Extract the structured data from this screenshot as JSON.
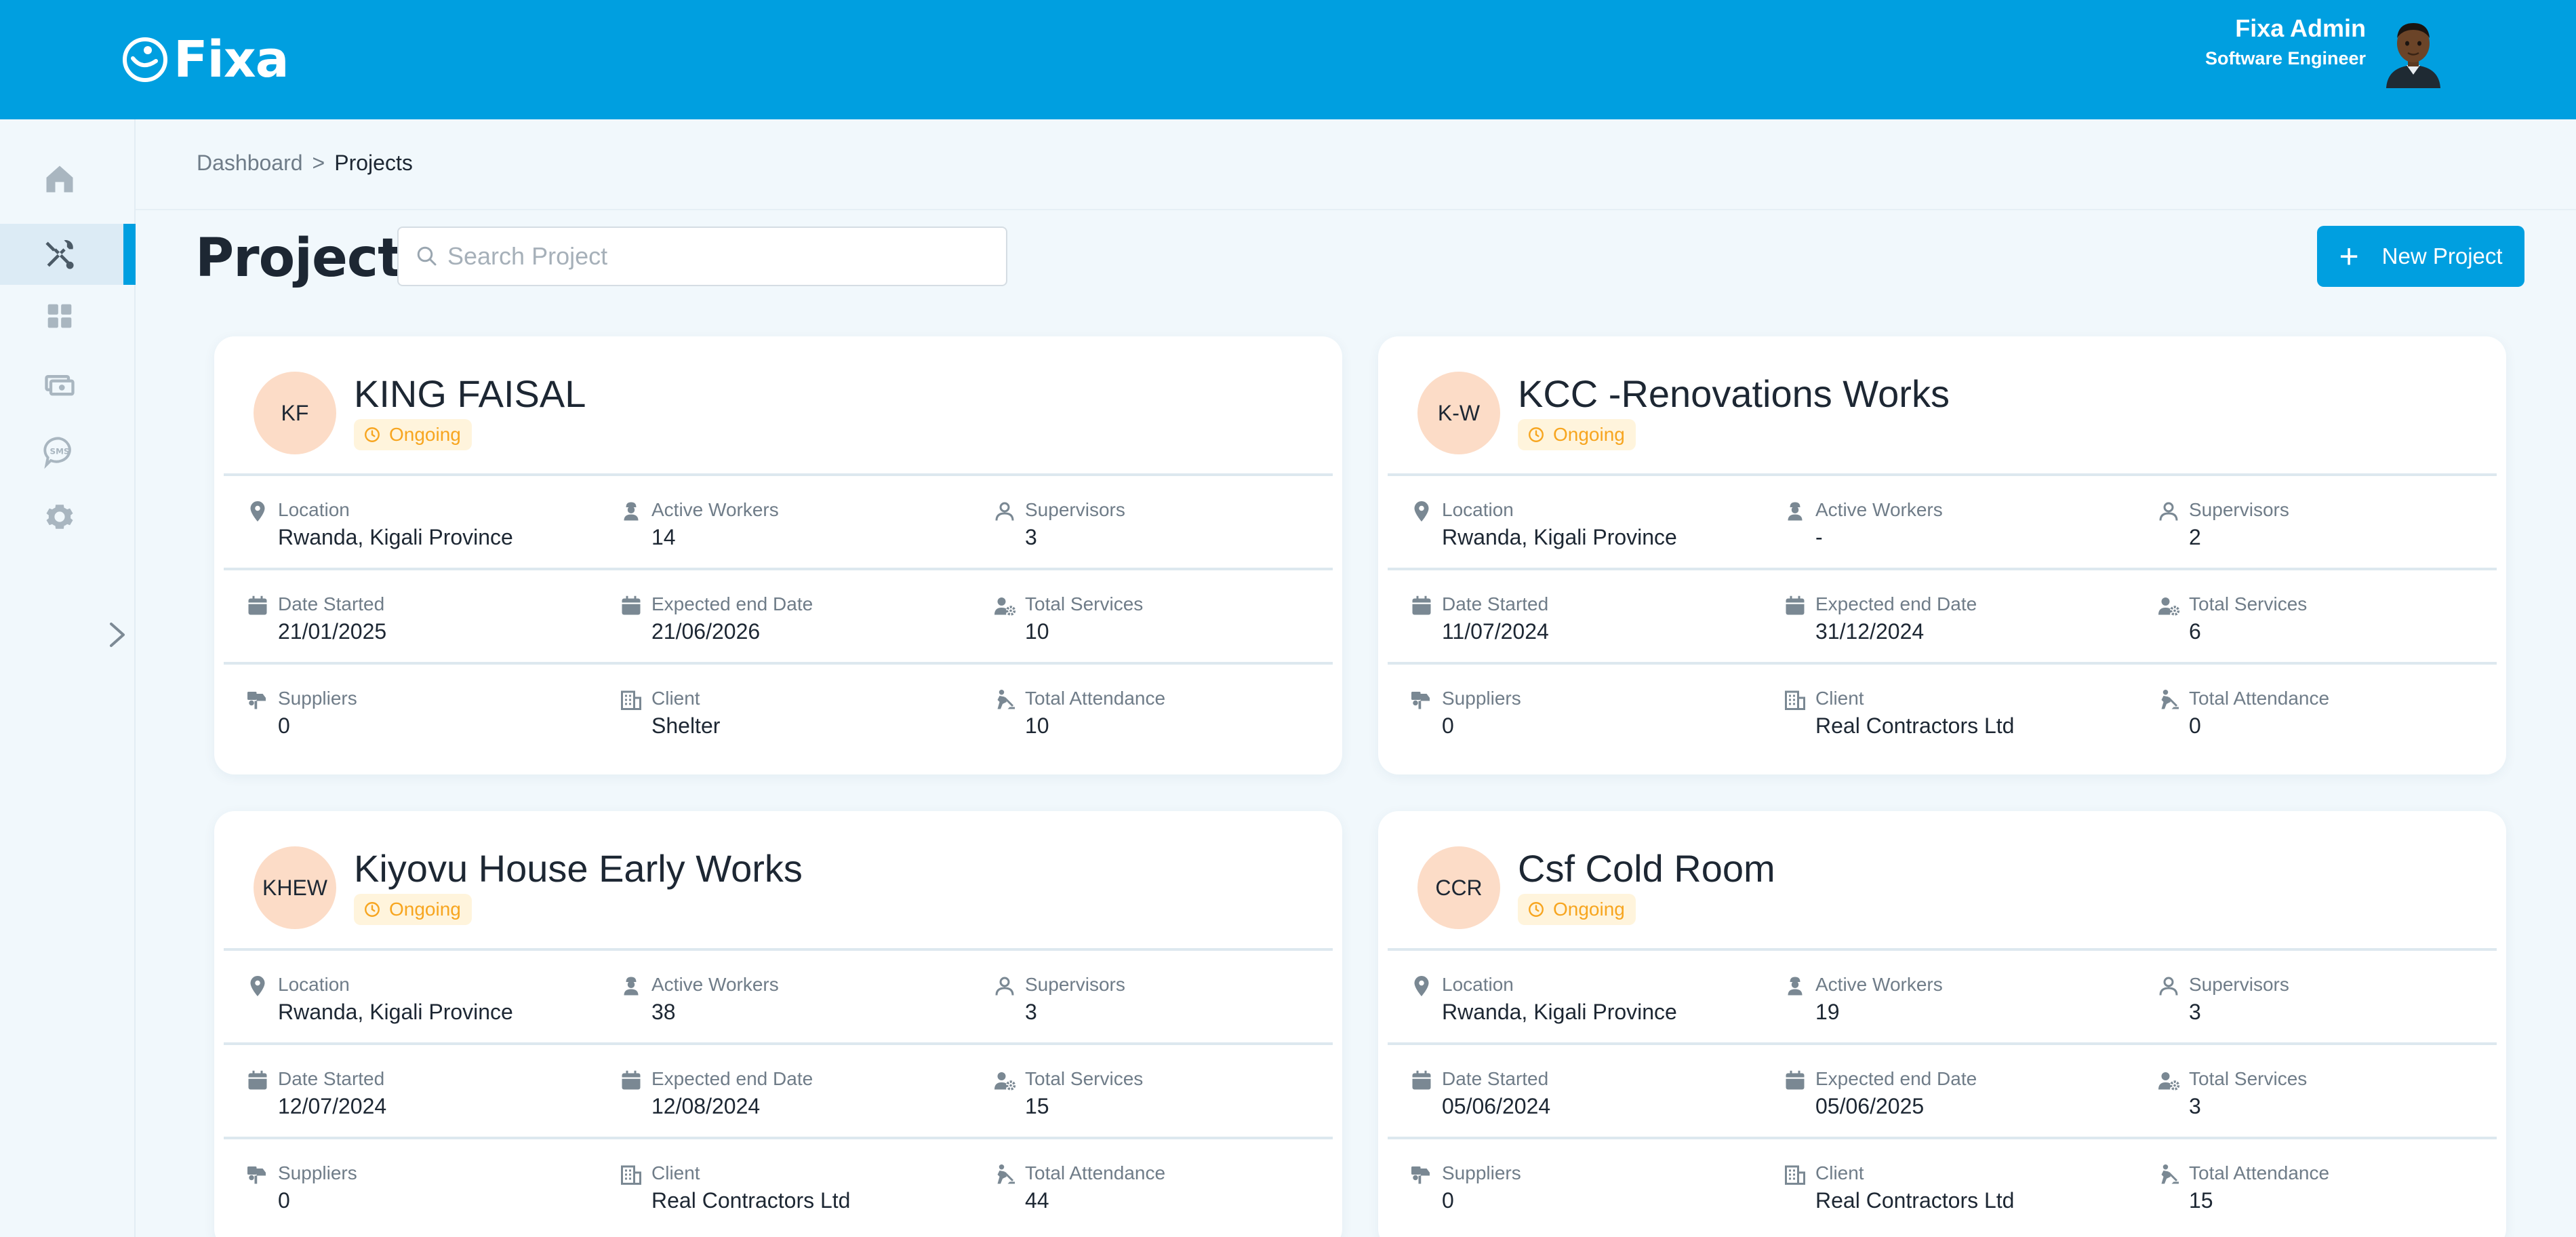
{
  "app": {
    "name": "Fixa"
  },
  "user": {
    "name": "Fixa Admin",
    "role": "Software Engineer"
  },
  "breadcrumb": {
    "items": [
      "Dashboard",
      "Projects"
    ],
    "separator": ">"
  },
  "page": {
    "title": "Projects"
  },
  "search": {
    "placeholder": "Search Project",
    "value": ""
  },
  "new_project_button": {
    "label": "New Project",
    "icon": "plus-icon"
  },
  "sidebar": {
    "items": [
      {
        "icon": "home-icon",
        "active": false
      },
      {
        "icon": "tools-icon",
        "active": true
      },
      {
        "icon": "grid-icon",
        "active": false
      },
      {
        "icon": "cash-icon",
        "active": false
      },
      {
        "icon": "sms-icon",
        "active": false
      },
      {
        "icon": "gear-icon",
        "active": false
      }
    ]
  },
  "field_labels": {
    "location": "Location",
    "active_workers": "Active Workers",
    "supervisors": "Supervisors",
    "date_started": "Date Started",
    "expected_end": "Expected end Date",
    "total_services": "Total Services",
    "suppliers": "Suppliers",
    "client": "Client",
    "total_attendance": "Total Attendance"
  },
  "colors": {
    "brand": "#009fe0",
    "status": "#f7a51f",
    "initials_bg": "#fcdcc7"
  },
  "projects": [
    {
      "initials": "KF",
      "name": "KING FAISAL",
      "status": "Ongoing",
      "location": "Rwanda, Kigali Province",
      "active_workers": "14",
      "supervisors": "3",
      "date_started": "21/01/2025",
      "expected_end": "21/06/2026",
      "total_services": "10",
      "suppliers": "0",
      "client": "Shelter",
      "total_attendance": "10"
    },
    {
      "initials": "K-W",
      "name": "KCC -Renovations Works",
      "status": "Ongoing",
      "location": "Rwanda, Kigali Province",
      "active_workers": "-",
      "supervisors": "2",
      "date_started": "11/07/2024",
      "expected_end": "31/12/2024",
      "total_services": "6",
      "suppliers": "0",
      "client": "Real Contractors Ltd",
      "total_attendance": "0"
    },
    {
      "initials": "KHEW",
      "name": "Kiyovu House Early Works",
      "status": "Ongoing",
      "location": "Rwanda, Kigali Province",
      "active_workers": "38",
      "supervisors": "3",
      "date_started": "12/07/2024",
      "expected_end": "12/08/2024",
      "total_services": "15",
      "suppliers": "0",
      "client": "Real Contractors Ltd",
      "total_attendance": "44"
    },
    {
      "initials": "CCR",
      "name": "Csf Cold Room",
      "status": "Ongoing",
      "location": "Rwanda, Kigali Province",
      "active_workers": "19",
      "supervisors": "3",
      "date_started": "05/06/2024",
      "expected_end": "05/06/2025",
      "total_services": "3",
      "suppliers": "0",
      "client": "Real Contractors Ltd",
      "total_attendance": "15"
    }
  ]
}
